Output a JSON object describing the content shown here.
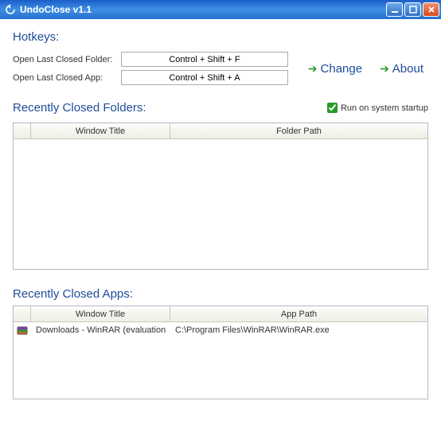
{
  "window": {
    "title": "UndoClose v1.1"
  },
  "sections": {
    "hotkeys_title": "Hotkeys:",
    "folders_title": "Recently Closed Folders:",
    "apps_title": "Recently Closed Apps:"
  },
  "hotkeys": {
    "folder_label": "Open Last Closed Folder:",
    "folder_value": "Control + Shift + F",
    "app_label": "Open Last Closed App:",
    "app_value": "Control + Shift + A"
  },
  "buttons": {
    "change": "Change",
    "about": "About"
  },
  "startup": {
    "label": "Run on system startup",
    "checked": true
  },
  "folders_table": {
    "col1": "Window Title",
    "col2": "Folder Path",
    "rows": []
  },
  "apps_table": {
    "col1": "Window Title",
    "col2": "App Path",
    "rows": [
      {
        "title": "Downloads - WinRAR (evaluation",
        "path": "C:\\Program Files\\WinRAR\\WinRAR.exe"
      }
    ]
  }
}
